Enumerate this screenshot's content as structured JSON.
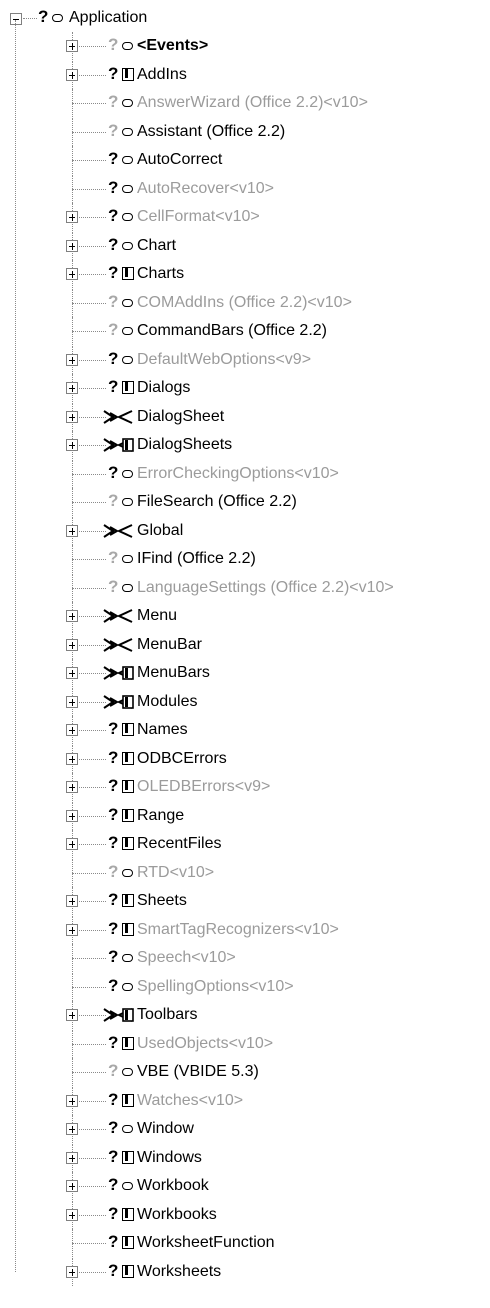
{
  "root": {
    "label": "Application",
    "expanded": true,
    "marker": "?",
    "icon": "object-icon"
  },
  "items": [
    {
      "label": "<Events>",
      "expander": true,
      "kind": "object",
      "marker": "?",
      "grey_marker": true,
      "grey_text": false,
      "bold": true
    },
    {
      "label": "AddIns",
      "expander": true,
      "kind": "collection",
      "marker": "?",
      "grey_marker": false,
      "grey_text": false
    },
    {
      "label": "AnswerWizard (Office 2.2)<v10>",
      "expander": false,
      "kind": "object",
      "marker": "?",
      "grey_marker": true,
      "grey_text": true
    },
    {
      "label": "Assistant (Office 2.2)",
      "expander": false,
      "kind": "object",
      "marker": "?",
      "grey_marker": true,
      "grey_text": false
    },
    {
      "label": "AutoCorrect",
      "expander": false,
      "kind": "object",
      "marker": "?",
      "grey_marker": false,
      "grey_text": false
    },
    {
      "label": "AutoRecover<v10>",
      "expander": false,
      "kind": "object",
      "marker": "?",
      "grey_marker": false,
      "grey_text": true
    },
    {
      "label": "CellFormat<v10>",
      "expander": true,
      "kind": "object",
      "marker": "?",
      "grey_marker": false,
      "grey_text": true
    },
    {
      "label": "Chart",
      "expander": true,
      "kind": "object",
      "marker": "?",
      "grey_marker": false,
      "grey_text": false
    },
    {
      "label": "Charts",
      "expander": true,
      "kind": "collection",
      "marker": "?",
      "grey_marker": false,
      "grey_text": false
    },
    {
      "label": "COMAddIns (Office 2.2)<v10>",
      "expander": false,
      "kind": "object",
      "marker": "?",
      "grey_marker": true,
      "grey_text": true
    },
    {
      "label": "CommandBars (Office 2.2)",
      "expander": false,
      "kind": "object",
      "marker": "?",
      "grey_marker": true,
      "grey_text": false
    },
    {
      "label": "DefaultWebOptions<v9>",
      "expander": true,
      "kind": "object",
      "marker": "?",
      "grey_marker": false,
      "grey_text": true
    },
    {
      "label": "Dialogs",
      "expander": true,
      "kind": "collection",
      "marker": "?",
      "grey_marker": false,
      "grey_text": false
    },
    {
      "label": "DialogSheet",
      "expander": true,
      "kind": "bowtie",
      "grey_text": false
    },
    {
      "label": "DialogSheets",
      "expander": true,
      "kind": "bowtie-coll",
      "grey_text": false
    },
    {
      "label": "ErrorCheckingOptions<v10>",
      "expander": false,
      "kind": "object",
      "marker": "?",
      "grey_marker": false,
      "grey_text": true
    },
    {
      "label": "FileSearch (Office 2.2)",
      "expander": false,
      "kind": "object",
      "marker": "?",
      "grey_marker": true,
      "grey_text": false
    },
    {
      "label": "Global",
      "expander": true,
      "kind": "bowtie",
      "grey_text": false
    },
    {
      "label": "IFind (Office 2.2)",
      "expander": false,
      "kind": "object",
      "marker": "?",
      "grey_marker": true,
      "grey_text": false
    },
    {
      "label": "LanguageSettings (Office 2.2)<v10>",
      "expander": false,
      "kind": "object",
      "marker": "?",
      "grey_marker": true,
      "grey_text": true
    },
    {
      "label": "Menu",
      "expander": true,
      "kind": "bowtie",
      "grey_text": false
    },
    {
      "label": "MenuBar",
      "expander": true,
      "kind": "bowtie",
      "grey_text": false
    },
    {
      "label": "MenuBars",
      "expander": true,
      "kind": "bowtie-coll",
      "grey_text": false
    },
    {
      "label": "Modules",
      "expander": true,
      "kind": "bowtie-coll",
      "grey_text": false
    },
    {
      "label": "Names",
      "expander": true,
      "kind": "collection",
      "marker": "?",
      "grey_marker": false,
      "grey_text": false
    },
    {
      "label": "ODBCErrors",
      "expander": true,
      "kind": "collection",
      "marker": "?",
      "grey_marker": false,
      "grey_text": false
    },
    {
      "label": "OLEDBErrors<v9>",
      "expander": true,
      "kind": "collection",
      "marker": "?",
      "grey_marker": false,
      "grey_text": true
    },
    {
      "label": "Range",
      "expander": true,
      "kind": "collection",
      "marker": "?",
      "grey_marker": false,
      "grey_text": false
    },
    {
      "label": "RecentFiles",
      "expander": true,
      "kind": "collection",
      "marker": "?",
      "grey_marker": false,
      "grey_text": false
    },
    {
      "label": "RTD<v10>",
      "expander": false,
      "kind": "object",
      "marker": "?",
      "grey_marker": true,
      "grey_text": true
    },
    {
      "label": "Sheets",
      "expander": true,
      "kind": "collection",
      "marker": "?",
      "grey_marker": false,
      "grey_text": false
    },
    {
      "label": "SmartTagRecognizers<v10>",
      "expander": true,
      "kind": "collection",
      "marker": "?",
      "grey_marker": false,
      "grey_text": true
    },
    {
      "label": "Speech<v10>",
      "expander": false,
      "kind": "object",
      "marker": "?",
      "grey_marker": false,
      "grey_text": true
    },
    {
      "label": "SpellingOptions<v10>",
      "expander": false,
      "kind": "object",
      "marker": "?",
      "grey_marker": false,
      "grey_text": true
    },
    {
      "label": "Toolbars",
      "expander": true,
      "kind": "bowtie-coll",
      "grey_text": false
    },
    {
      "label": "UsedObjects<v10>",
      "expander": false,
      "kind": "collection",
      "marker": "?",
      "grey_marker": false,
      "grey_text": true
    },
    {
      "label": "VBE (VBIDE 5.3)",
      "expander": false,
      "kind": "object",
      "marker": "?",
      "grey_marker": true,
      "grey_text": false
    },
    {
      "label": "Watches<v10>",
      "expander": true,
      "kind": "collection",
      "marker": "?",
      "grey_marker": false,
      "grey_text": true
    },
    {
      "label": "Window",
      "expander": true,
      "kind": "object",
      "marker": "?",
      "grey_marker": false,
      "grey_text": false
    },
    {
      "label": "Windows",
      "expander": true,
      "kind": "collection",
      "marker": "?",
      "grey_marker": false,
      "grey_text": false
    },
    {
      "label": "Workbook",
      "expander": true,
      "kind": "object",
      "marker": "?",
      "grey_marker": false,
      "grey_text": false
    },
    {
      "label": "Workbooks",
      "expander": true,
      "kind": "collection",
      "marker": "?",
      "grey_marker": false,
      "grey_text": false
    },
    {
      "label": "WorksheetFunction",
      "expander": false,
      "kind": "collection",
      "marker": "?",
      "grey_marker": false,
      "grey_text": false
    },
    {
      "label": "Worksheets",
      "expander": true,
      "kind": "collection",
      "marker": "?",
      "grey_marker": false,
      "grey_text": false
    }
  ]
}
